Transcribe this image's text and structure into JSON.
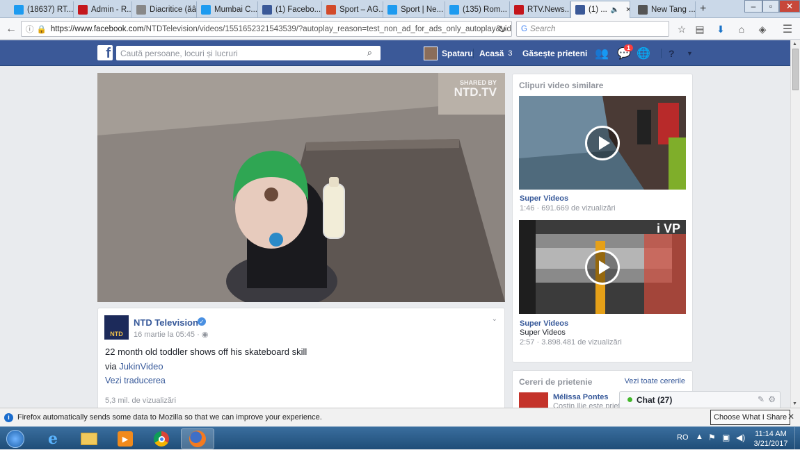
{
  "browser": {
    "tabs": [
      {
        "label": "(18637) RT...",
        "color": "#1d9bf0",
        "icon": "twitter-icon"
      },
      {
        "label": "Admin - R...",
        "color": "#c4161c",
        "icon": "rtv-icon"
      },
      {
        "label": "Diacritice (ăâîș...",
        "color": "#888888",
        "icon": "page-icon"
      },
      {
        "label": "Mumbai C...",
        "color": "#1d9bf0",
        "icon": "twitter-icon"
      },
      {
        "label": "(1) Facebo...",
        "color": "#3b5998",
        "icon": "facebook-icon"
      },
      {
        "label": "Sport – AG...",
        "color": "#d24a2a",
        "icon": "page-icon"
      },
      {
        "label": "Sport | Ne...",
        "color": "#1d9bf0",
        "icon": "twitter-icon"
      },
      {
        "label": "(135) Rom...",
        "color": "#1d9bf0",
        "icon": "twitter-icon"
      },
      {
        "label": "RTV.News...",
        "color": "#c4161c",
        "icon": "rtv-icon"
      },
      {
        "label": "(1) ...",
        "color": "#3b5998",
        "icon": "facebook-icon"
      },
      {
        "label": "New Tang ...",
        "color": "#555555",
        "icon": "wikipedia-icon"
      }
    ],
    "new_tab": "+",
    "url_domain": "https://www.facebook.com",
    "url_rest": "/NTDTelevision/videos/1551652321543539/?autoplay_reason=test_non_ad_for_ads_only_autoplay&video_cont",
    "search_placeholder": "Search",
    "notification": "Firefox automatically sends some data to Mozilla so that we can improve your experience.",
    "notification_button": "Choose What I Share"
  },
  "facebook": {
    "search_placeholder": "Caută persoane, locuri și lucruri",
    "profile_name": "Spataru",
    "home_label": "Acasă",
    "home_count": "3",
    "find_friends": "Găsește prieteni",
    "messages_badge": "1",
    "brand_color": "#3b5998"
  },
  "video": {
    "watermark_line1": "SHARED BY",
    "watermark_line2": "NTD.TV"
  },
  "post": {
    "page_name": "NTD Television",
    "logo_text": "NTD",
    "date": "16 martie la 05:45",
    "text": "22 month old toddler shows off his skateboard skill",
    "via_prefix": "via ",
    "via_link": "JukinVideo",
    "translate": "Vezi traducerea",
    "views": "5,3 mil. de vizualizări"
  },
  "related": {
    "title": "Clipuri video similare",
    "items": [
      {
        "channel": "Super Videos",
        "subtitle": "",
        "duration": "1:46",
        "views": "691.669 de vizualizări"
      },
      {
        "channel": "Super Videos",
        "subtitle": "Super Videos",
        "duration": "2:57",
        "views": "3.898.481 de vizualizări",
        "overlay": "i VP"
      }
    ]
  },
  "friends": {
    "title": "Cereri de prietenie",
    "see_all": "Vezi toate cererile",
    "name": "Mélissa Pontes",
    "mutual": "Costin Ilie este priet"
  },
  "chat": {
    "label": "Chat (27)"
  },
  "taskbar": {
    "language": "RO",
    "time": "11:14 AM",
    "date": "3/21/2017"
  }
}
